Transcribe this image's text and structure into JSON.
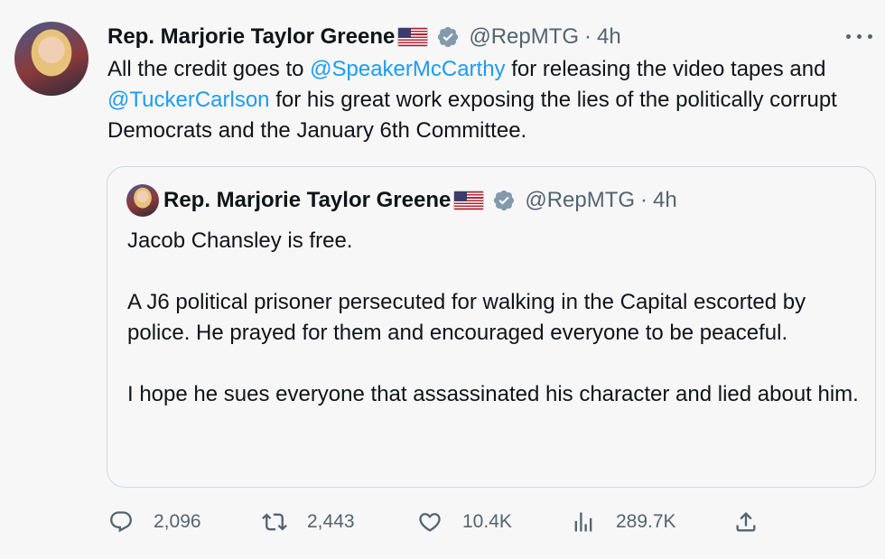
{
  "tweet": {
    "author_name": "Rep. Marjorie Taylor Greene",
    "flag_emoji": "us-flag",
    "verified_icon": "verified-badge-icon",
    "handle": "@RepMTG",
    "separator": "·",
    "time": "4h",
    "text_before_1": "All the credit goes to ",
    "mention_1": "@SpeakerMcCarthy",
    "text_between": " for releasing the video tapes and ",
    "mention_2": "@TuckerCarlson",
    "text_after": " for his great work exposing the lies of the politically corrupt Democrats and the January 6th Committee.",
    "mention_color": "#1d9bf0"
  },
  "quote": {
    "author_name": "Rep. Marjorie Taylor Greene",
    "handle": "@RepMTG",
    "separator": "·",
    "time": "4h",
    "paragraphs": [
      "Jacob Chansley is free.",
      "A J6 political prisoner persecuted for walking in the Capital escorted by police.  He prayed for them and encouraged everyone to be peaceful.",
      "I hope he sues everyone that assassinated his character and lied about him."
    ]
  },
  "actions": {
    "replies": "2,096",
    "retweets": "2,443",
    "likes": "10.4K",
    "views": "289.7K"
  }
}
